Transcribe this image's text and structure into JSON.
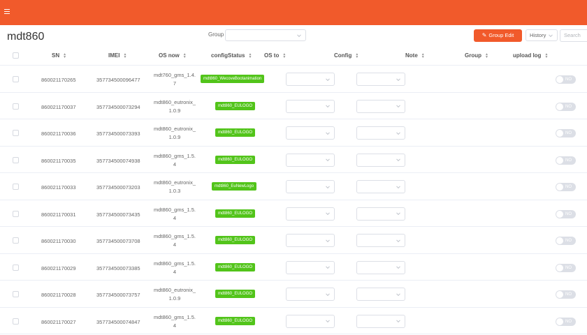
{
  "app": {
    "title": "mdt860",
    "accent": "#f15a2b",
    "menu_icon": "menu-icon"
  },
  "filter": {
    "group_label": "Group",
    "group_value": ""
  },
  "toolbar": {
    "group_edit_label": "Group Edit",
    "group_edit_icon": "edit-icon",
    "history_label": "History",
    "search_placeholder": "Search"
  },
  "table": {
    "columns": [
      "SN",
      "IMEI",
      "OS now",
      "configStatus",
      "OS to",
      "Config",
      "Note",
      "Group",
      "upload log"
    ],
    "rows": [
      {
        "sn": "860021170265",
        "imei": "357734500096477",
        "os_now": "mdt760_gms_1.4.7",
        "config_status": "mdt860_WecoveBootanimation",
        "os_to": "",
        "config": "",
        "note": "",
        "group": "",
        "upload_log": "NO"
      },
      {
        "sn": "860021170037",
        "imei": "357734500073294",
        "os_now": "mdt860_eutronix_1.0.9",
        "config_status": "mdt860_EULOGO",
        "os_to": "",
        "config": "",
        "note": "",
        "group": "",
        "upload_log": "NO"
      },
      {
        "sn": "860021170036",
        "imei": "357734500073393",
        "os_now": "mdt860_eutronix_1.0.9",
        "config_status": "mdt860_EULOGO",
        "os_to": "",
        "config": "",
        "note": "",
        "group": "",
        "upload_log": "NO"
      },
      {
        "sn": "860021170035",
        "imei": "357734500074938",
        "os_now": "mdt860_gms_1.5.4",
        "config_status": "mdt860_EULOGO",
        "os_to": "",
        "config": "",
        "note": "",
        "group": "",
        "upload_log": "NO"
      },
      {
        "sn": "860021170033",
        "imei": "357734500073203",
        "os_now": "mdt860_eutronix_1.0.3",
        "config_status": "mdt860_EuNewLogo",
        "os_to": "",
        "config": "",
        "note": "",
        "group": "",
        "upload_log": "NO"
      },
      {
        "sn": "860021170031",
        "imei": "357734500073435",
        "os_now": "mdt860_gms_1.5.4",
        "config_status": "mdt860_EULOGO",
        "os_to": "",
        "config": "",
        "note": "",
        "group": "",
        "upload_log": "NO"
      },
      {
        "sn": "860021170030",
        "imei": "357734500073708",
        "os_now": "mdt860_gms_1.5.4",
        "config_status": "mdt860_EULOGO",
        "os_to": "",
        "config": "",
        "note": "",
        "group": "",
        "upload_log": "NO"
      },
      {
        "sn": "860021170029",
        "imei": "357734500073385",
        "os_now": "mdt860_gms_1.5.4",
        "config_status": "mdt860_EULOGO",
        "os_to": "",
        "config": "",
        "note": "",
        "group": "",
        "upload_log": "NO"
      },
      {
        "sn": "860021170028",
        "imei": "357734500073757",
        "os_now": "mdt860_eutronix_1.0.9",
        "config_status": "mdt860_EULOGO",
        "os_to": "",
        "config": "",
        "note": "",
        "group": "",
        "upload_log": "NO"
      },
      {
        "sn": "860021170027",
        "imei": "357734500074847",
        "os_now": "mdt860_gms_1.5.4",
        "config_status": "mdt860_EULOGO",
        "os_to": "",
        "config": "",
        "note": "",
        "group": "",
        "upload_log": "NO"
      }
    ]
  }
}
